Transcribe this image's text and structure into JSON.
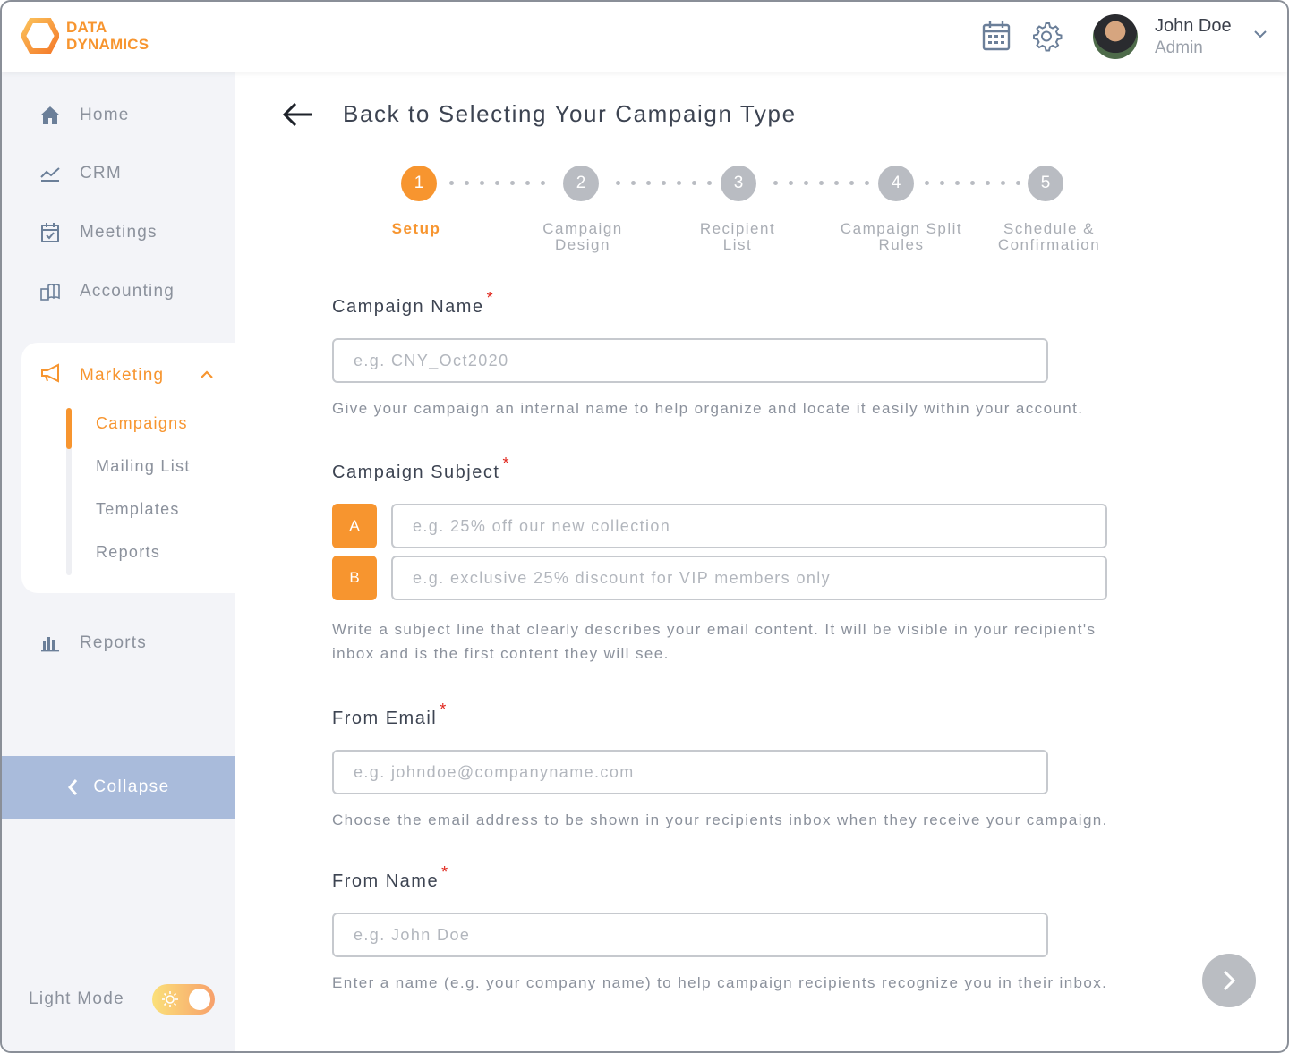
{
  "brand": {
    "line1": "DATA",
    "line2": "DYNAMICS",
    "accent": "#f7952f"
  },
  "header": {
    "icons": [
      "calendar-icon",
      "gear-icon"
    ],
    "user": {
      "name": "John Doe",
      "role": "Admin"
    }
  },
  "sidebar": {
    "items": [
      {
        "label": "Home",
        "icon": "home-icon"
      },
      {
        "label": "CRM",
        "icon": "chart-line-icon"
      },
      {
        "label": "Meetings",
        "icon": "calendar-check-icon"
      },
      {
        "label": "Accounting",
        "icon": "accounting-icon"
      }
    ],
    "marketing": {
      "label": "Marketing",
      "icon": "megaphone-icon",
      "sub": [
        "Campaigns",
        "Mailing List",
        "Templates",
        "Reports"
      ],
      "active": "Campaigns"
    },
    "reports": {
      "label": "Reports",
      "icon": "bar-chart-icon"
    },
    "collapse_label": "Collapse",
    "light_mode_label": "Light Mode"
  },
  "page": {
    "back_title": "Back to Selecting Your Campaign Type"
  },
  "stepper": {
    "steps": [
      {
        "num": "1",
        "line1": "Setup",
        "line2": ""
      },
      {
        "num": "2",
        "line1": "Campaign",
        "line2": "Design"
      },
      {
        "num": "3",
        "line1": "Recipient",
        "line2": "List"
      },
      {
        "num": "4",
        "line1": "Campaign Split",
        "line2": "Rules"
      },
      {
        "num": "5",
        "line1": "Schedule &",
        "line2": "Confirmation"
      }
    ],
    "active": 1
  },
  "form": {
    "campaign_name": {
      "label": "Campaign Name",
      "placeholder": "e.g. CNY_Oct2020",
      "help": "Give your campaign an internal name to help organize and locate it easily within your account."
    },
    "campaign_subject": {
      "label": "Campaign Subject",
      "a_badge": "A",
      "a_placeholder": "e.g. 25% off our new collection",
      "b_badge": "B",
      "b_placeholder": "e.g. exclusive 25% discount for VIP members only",
      "help_line1": "Write a subject line that clearly describes your email content. It will be visible in your recipient's",
      "help_line2": "inbox and is the first content they will see."
    },
    "from_email": {
      "label": "From Email",
      "placeholder": "e.g. johndoe@companyname.com",
      "help": "Choose the email address to be shown in your recipients inbox when they receive your campaign."
    },
    "from_name": {
      "label": "From Name",
      "placeholder": "e.g. John Doe",
      "help": "Enter a name (e.g. your company name) to help campaign recipients recognize you in their inbox."
    },
    "required_mark": "*"
  }
}
